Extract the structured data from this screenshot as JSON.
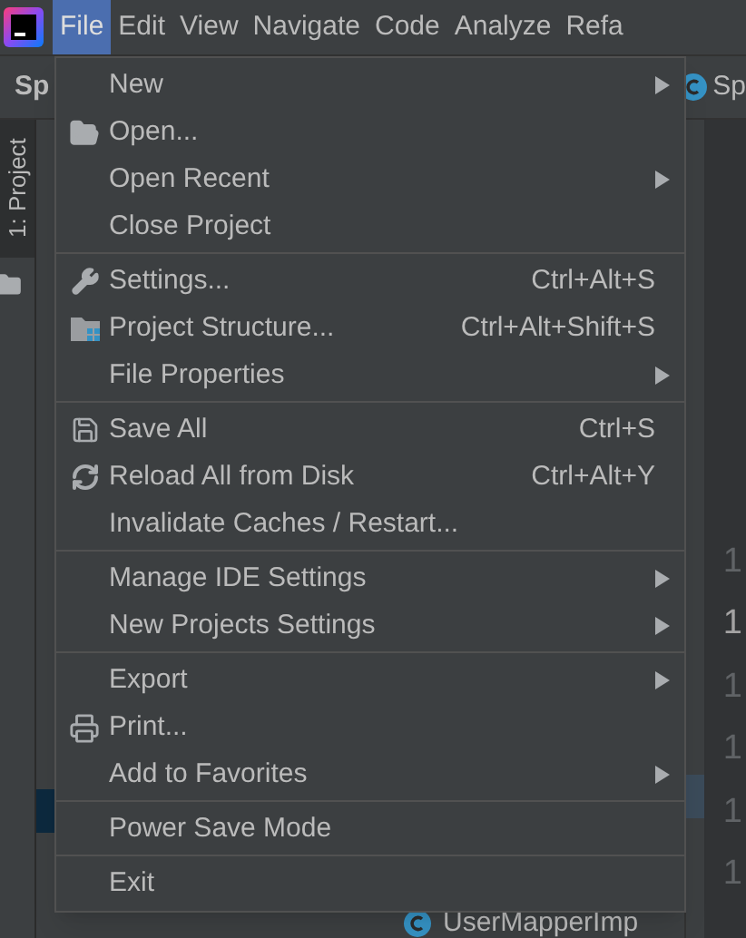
{
  "menubar": {
    "items": [
      {
        "label": "File",
        "selected": true
      },
      {
        "label": "Edit",
        "selected": false
      },
      {
        "label": "View",
        "selected": false
      },
      {
        "label": "Navigate",
        "selected": false
      },
      {
        "label": "Code",
        "selected": false
      },
      {
        "label": "Analyze",
        "selected": false
      },
      {
        "label": "Refa",
        "selected": false
      }
    ]
  },
  "navbar": {
    "left_tab": "Sp",
    "right_tab": "Sp"
  },
  "side_tab": {
    "label": "1: Project",
    "selected": true
  },
  "file_menu": {
    "sections": [
      [
        {
          "label": "New",
          "submenu": true
        },
        {
          "label": "Open...",
          "submenu": false
        },
        {
          "label": "Open Recent",
          "submenu": true
        },
        {
          "label": "Close Project",
          "submenu": false
        }
      ],
      [
        {
          "label": "Settings...",
          "shortcut": "Ctrl+Alt+S",
          "submenu": false
        },
        {
          "label": "Project Structure...",
          "shortcut": "Ctrl+Alt+Shift+S",
          "submenu": false
        },
        {
          "label": "File Properties",
          "submenu": true
        }
      ],
      [
        {
          "label": "Save All",
          "shortcut": "Ctrl+S",
          "submenu": false
        },
        {
          "label": "Reload All from Disk",
          "shortcut": "Ctrl+Alt+Y",
          "submenu": false
        },
        {
          "label": "Invalidate Caches / Restart...",
          "submenu": false
        }
      ],
      [
        {
          "label": "Manage IDE Settings",
          "submenu": true
        },
        {
          "label": "New Projects Settings",
          "submenu": true
        }
      ],
      [
        {
          "label": "Export",
          "submenu": true
        },
        {
          "label": "Print...",
          "submenu": false
        },
        {
          "label": "Add to Favorites",
          "submenu": true
        }
      ],
      [
        {
          "label": "Power Save Mode",
          "submenu": false
        }
      ],
      [
        {
          "label": "Exit",
          "submenu": false
        }
      ]
    ]
  },
  "project_tree": {
    "bottom_item": "UserMapperImp"
  },
  "editor": {
    "line_numbers": [
      {
        "text": "1",
        "selected": false
      },
      {
        "text": "1",
        "selected": true
      },
      {
        "text": "1",
        "selected": false
      },
      {
        "text": "1",
        "selected": false
      },
      {
        "text": "1",
        "selected": false
      },
      {
        "text": "1",
        "selected": false
      }
    ]
  }
}
